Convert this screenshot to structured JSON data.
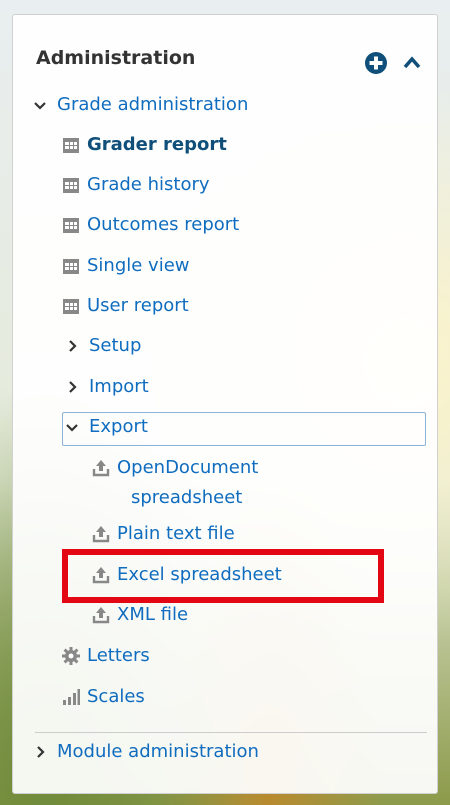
{
  "block": {
    "title": "Administration"
  },
  "tree": {
    "grade_admin": "Grade administration",
    "grader_report": "Grader report",
    "grade_history": "Grade history",
    "outcomes_report": "Outcomes report",
    "single_view": "Single view",
    "user_report": "User report",
    "setup": "Setup",
    "import": "Import",
    "export": "Export",
    "opendocument_line1": "OpenDocument",
    "opendocument_line2": "spreadsheet",
    "plain_text": "Plain text file",
    "excel": "Excel spreadsheet",
    "xml": "XML file",
    "letters": "Letters",
    "scales": "Scales",
    "module_admin": "Module administration"
  },
  "colors": {
    "link": "#0f6cbf",
    "highlight": "#e30613"
  }
}
